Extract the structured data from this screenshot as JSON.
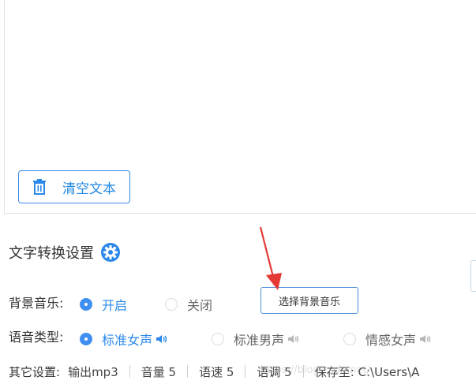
{
  "text_area": {
    "clear_button_label": "清空文本",
    "clear_icon": "trash-icon"
  },
  "settings": {
    "title": "文字转换设置",
    "title_icon": "gear-icon",
    "accent_color": "#2b88ea"
  },
  "background_music": {
    "label": "背景音乐:",
    "options": [
      {
        "label": "开启",
        "checked": true
      },
      {
        "label": "关闭",
        "checked": false
      }
    ],
    "choose_button_label": "选择背景音乐"
  },
  "voice_type": {
    "label": "语音类型:",
    "options": [
      {
        "label": "标准女声",
        "checked": true,
        "icon": "speaker-icon"
      },
      {
        "label": "标准男声",
        "checked": false,
        "icon": "speaker-icon"
      },
      {
        "label": "情感女声",
        "checked": false,
        "icon": "speaker-icon"
      }
    ]
  },
  "other_settings": {
    "label": "其它设置:",
    "items": [
      "输出mp3",
      "音量 5",
      "语速 5",
      "语调 5",
      "保存至: C:\\Users\\A"
    ]
  },
  "watermark": "https://blog.csdn.net/..."
}
